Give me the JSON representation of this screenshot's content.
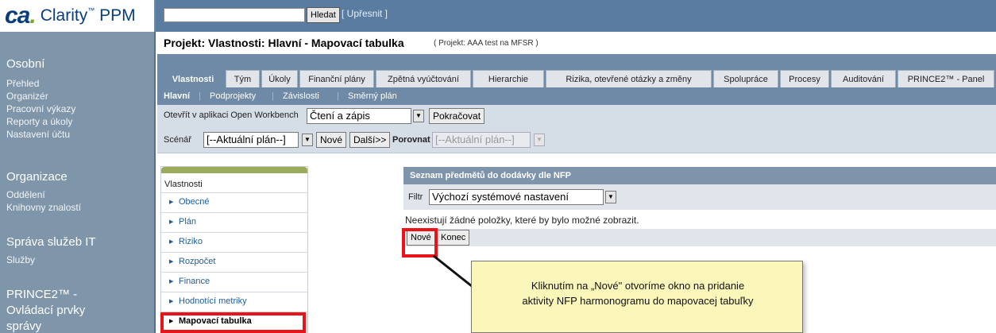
{
  "app": {
    "logo_mark": "ca",
    "logo_text": "Clarity",
    "logo_tm": "™",
    "logo_suffix": "PPM"
  },
  "search": {
    "value": "",
    "button_label": "Hledat",
    "refine_link": "[ Upřesnit ]"
  },
  "nav": {
    "sections": [
      {
        "title": "Osobní",
        "items": [
          "Přehled",
          "Organizér",
          "Pracovní výkazy",
          "Reporty a úkoly",
          "Nastavení účtu"
        ]
      },
      {
        "title": "Organizace",
        "items": [
          "Oddělení",
          "Knihovny znalostí"
        ]
      },
      {
        "title": "Správa služeb IT",
        "items": [
          "Služby"
        ]
      },
      {
        "title_lines": [
          "PRINCE2™ -",
          "Ovládací prvky",
          "správy"
        ]
      }
    ]
  },
  "page": {
    "title": "Projekt: Vlastnosti: Hlavní - Mapovací tabulka",
    "subtitle": "( Projekt: AAA test na MFSR )"
  },
  "tabs": [
    "Vlastnosti",
    "Tým",
    "Úkoly",
    "Finanční plány",
    "Zpětná vyúčtování",
    "Hierarchie",
    "Rizika, otevřené otázky a změny",
    "Spolupráce",
    "Procesy",
    "Auditování",
    "PRINCE2™ - Panel"
  ],
  "active_tab": "Vlastnosti",
  "subtabs": [
    "Hlavní",
    "Podprojekty",
    "Závislosti",
    "Směrný plán"
  ],
  "active_subtab": "Hlavní",
  "open_workbench": {
    "label": "Otevřít v aplikaci Open Workbench",
    "mode_value": "Čtení a zápis",
    "continue_button": "Pokračovat"
  },
  "scenario": {
    "label": "Scénář",
    "value": "[--Aktuální plán--]",
    "new_button": "Nové",
    "next_button": "Další>>",
    "compare_label": "Porovnat",
    "compare_value": "[--Aktuální plán--]"
  },
  "properties_panel": {
    "heading": "Vlastnosti",
    "items": [
      "Obecné",
      "Plán",
      "Riziko",
      "Rozpočet",
      "Finance",
      "Hodnotící metriky",
      "Mapovací tabulka"
    ],
    "selected": "Mapovací tabulka"
  },
  "list": {
    "title": "Seznam předmětů do dodávky dle NFP",
    "filter_label": "Filtr",
    "filter_value": "Výchozí systémové nastavení",
    "empty_message": "Neexistují žádné položky, které by bylo možné zobrazit.",
    "new_button": "Nové",
    "end_button": "Konec"
  },
  "callout": {
    "text_lines": [
      "Kliknutím na „Nové\" otvoríme okno na pridanie",
      "aktivity NFP harmonogramu do mapovacej tabuľky"
    ]
  },
  "colors": {
    "highlight": "#e8141a",
    "nav_background": "#7f95aa",
    "header_background": "#5a7ca0",
    "callout_background": "#fbf6b9"
  }
}
